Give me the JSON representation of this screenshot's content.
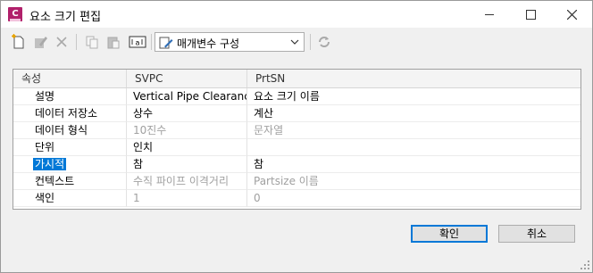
{
  "window": {
    "title": "요소 크기 편집",
    "app_icon_letter": "C"
  },
  "toolbar": {
    "combo_value": "매개변수 구성"
  },
  "grid": {
    "headers": [
      "속성",
      "SVPC",
      "PrtSN"
    ],
    "rows": [
      {
        "label": "설명",
        "svpc": "Vertical Pipe Clearance",
        "prtsn": "요소 크기 이름",
        "svpc_grey": false,
        "prtsn_grey": false
      },
      {
        "label": "데이터 저장소",
        "svpc": "상수",
        "prtsn": "계산",
        "svpc_grey": false,
        "prtsn_grey": false
      },
      {
        "label": "데이터 형식",
        "svpc": "10진수",
        "prtsn": "문자열",
        "svpc_grey": true,
        "prtsn_grey": true
      },
      {
        "label": "단위",
        "svpc": "인치",
        "prtsn": "",
        "svpc_grey": false,
        "prtsn_grey": false
      },
      {
        "label": "가시적",
        "svpc": "참",
        "prtsn": "참",
        "svpc_grey": false,
        "prtsn_grey": false,
        "selected": true
      },
      {
        "label": "컨텍스트",
        "svpc": "수직 파이프 이격거리",
        "prtsn": "Partsize 이름",
        "svpc_grey": true,
        "prtsn_grey": true
      },
      {
        "label": "색인",
        "svpc": "1",
        "prtsn": "0",
        "svpc_grey": true,
        "prtsn_grey": true
      }
    ]
  },
  "buttons": {
    "ok": "확인",
    "cancel": "취소"
  },
  "colors": {
    "selection": "#0078d7",
    "app_icon": "#b1206b"
  }
}
